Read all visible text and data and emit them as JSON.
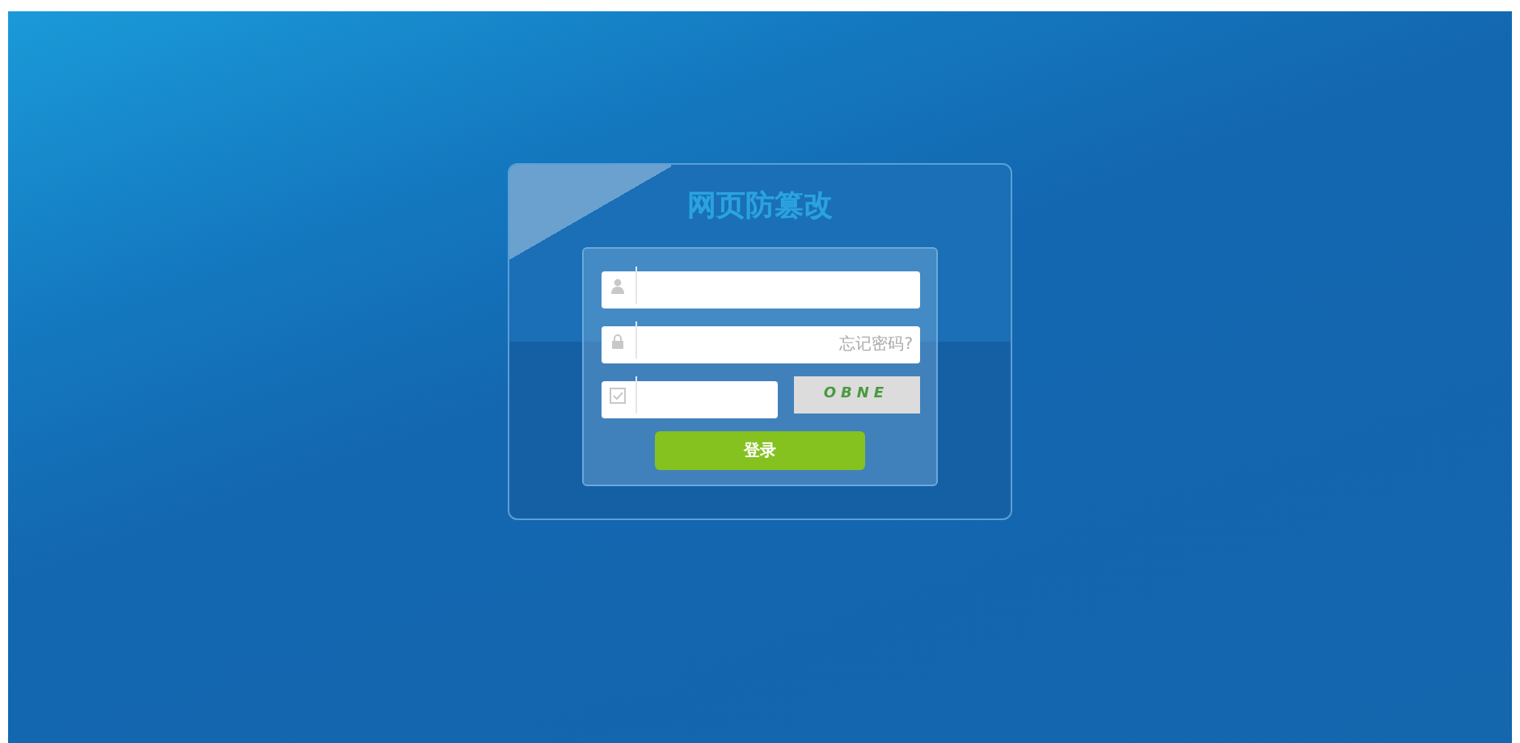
{
  "title": "网页防篡改",
  "fields": [
    {
      "kind": "username"
    },
    {
      "kind": "password",
      "placeholder": "忘记密码?"
    }
  ],
  "captcha": {
    "code": "OBNE"
  },
  "login_button": "登录"
}
